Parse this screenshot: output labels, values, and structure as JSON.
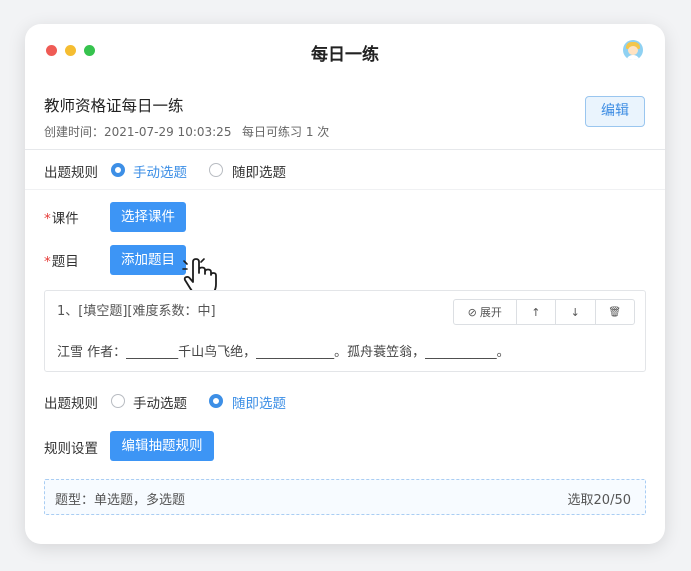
{
  "window": {
    "title": "每日一练"
  },
  "header": {
    "title": "教师资格证每日一练",
    "created": "创建时间：2021-07-29 10:03:25",
    "daily_limit": "每日可练习 1 次",
    "edit_label": "编辑"
  },
  "rule_section_1": {
    "label": "出题规则",
    "options": [
      {
        "label": "手动选题",
        "selected": true
      },
      {
        "label": "随即选题",
        "selected": false
      }
    ]
  },
  "courseware": {
    "required_mark": "*",
    "label": "课件",
    "button": "选择课件"
  },
  "questions": {
    "required_mark": "*",
    "label": "题目",
    "button": "添加题目"
  },
  "question_card": {
    "head": "1、[填空题][难度系数：中]",
    "body": "江雪 作者：________千山鸟飞绝，____________。孤舟蓑笠翁，___________。",
    "tools": {
      "expand": "展开",
      "up": "↑",
      "down": "↓",
      "delete": "🗑"
    }
  },
  "rule_section_2": {
    "label": "出题规则",
    "options": [
      {
        "label": "手动选题",
        "selected": false
      },
      {
        "label": "随即选题",
        "selected": true
      }
    ]
  },
  "rule_settings": {
    "label": "规则设置",
    "button": "编辑抽题规则"
  },
  "rule_summary": {
    "types": "题型：单选题，多选题",
    "count": "选取20/50"
  },
  "colors": {
    "accent": "#3d95f5",
    "required": "#e53935"
  }
}
